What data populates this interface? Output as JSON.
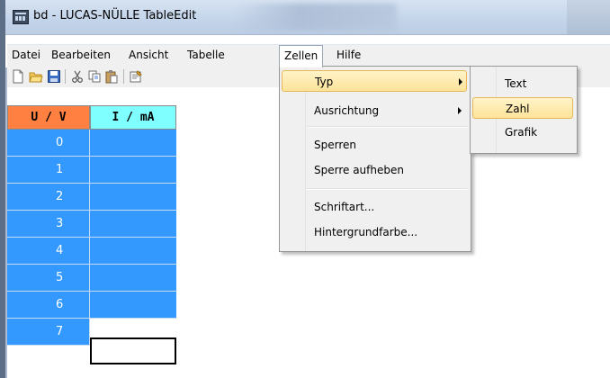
{
  "window": {
    "title": "bd - LUCAS-NÜLLE TableEdit"
  },
  "menubar": {
    "items": [
      "Datei",
      "Bearbeiten",
      "Ansicht",
      "Tabelle",
      "Zellen",
      "Hilfe"
    ],
    "active": "Zellen"
  },
  "toolbar": {
    "icons": [
      "new-document-icon",
      "open-folder-icon",
      "save-icon",
      "cut-icon",
      "copy-icon",
      "paste-icon",
      "properties-icon"
    ]
  },
  "table": {
    "columns": [
      "U / V",
      "I / mA"
    ],
    "column_colors": [
      "#ff8040",
      "#7fffff"
    ],
    "rows": [
      {
        "u": "0",
        "i": ""
      },
      {
        "u": "1",
        "i": ""
      },
      {
        "u": "2",
        "i": ""
      },
      {
        "u": "3",
        "i": ""
      },
      {
        "u": "4",
        "i": ""
      },
      {
        "u": "5",
        "i": ""
      },
      {
        "u": "6",
        "i": ""
      },
      {
        "u": "7",
        "i": ""
      }
    ],
    "selection_color": "#3399ff"
  },
  "zellen_menu": {
    "items": [
      "Typ",
      "Ausrichtung",
      "Sperren",
      "Sperre aufheben",
      "Schriftart...",
      "Hintergrundfarbe..."
    ],
    "highlighted": "Typ"
  },
  "typ_submenu": {
    "items": [
      "Text",
      "Zahl",
      "Grafik"
    ],
    "highlighted": "Zahl"
  }
}
